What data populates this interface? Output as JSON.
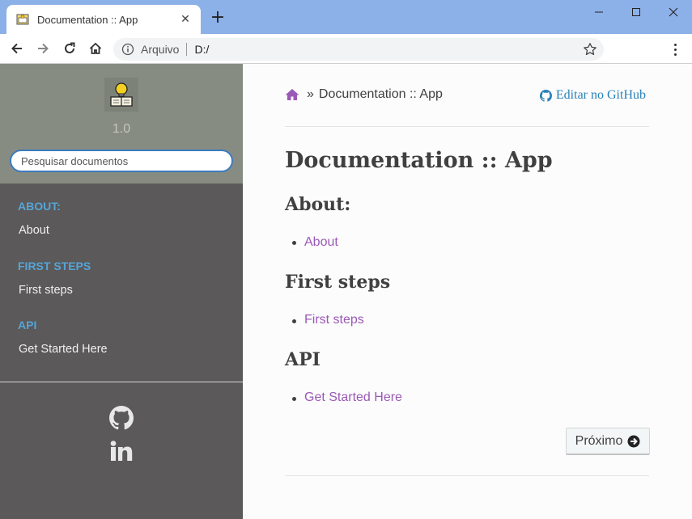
{
  "browser": {
    "tab_title": "Documentation :: App",
    "address_label": "Arquivo",
    "url": "D:/"
  },
  "sidebar": {
    "version": "1.0",
    "search_placeholder": "Pesquisar documentos",
    "sections": [
      {
        "caption": "ABOUT:",
        "item": "About"
      },
      {
        "caption": "FIRST STEPS",
        "item": "First steps"
      },
      {
        "caption": "API",
        "item": "Get Started Here"
      }
    ]
  },
  "content": {
    "breadcrumb_current": "Documentation :: App",
    "breadcrumb_separator": "»",
    "edit_link": "Editar no GitHub",
    "title": "Documentation :: App",
    "sections": [
      {
        "heading": "About:",
        "link": "About"
      },
      {
        "heading": "First steps",
        "link": "First steps"
      },
      {
        "heading": "API",
        "link": "Get Started Here"
      }
    ],
    "next_label": "Próximo"
  },
  "colors": {
    "link_purple": "#9b59b6",
    "caption_blue": "#55a5d9",
    "github_blue": "#2980b9"
  }
}
